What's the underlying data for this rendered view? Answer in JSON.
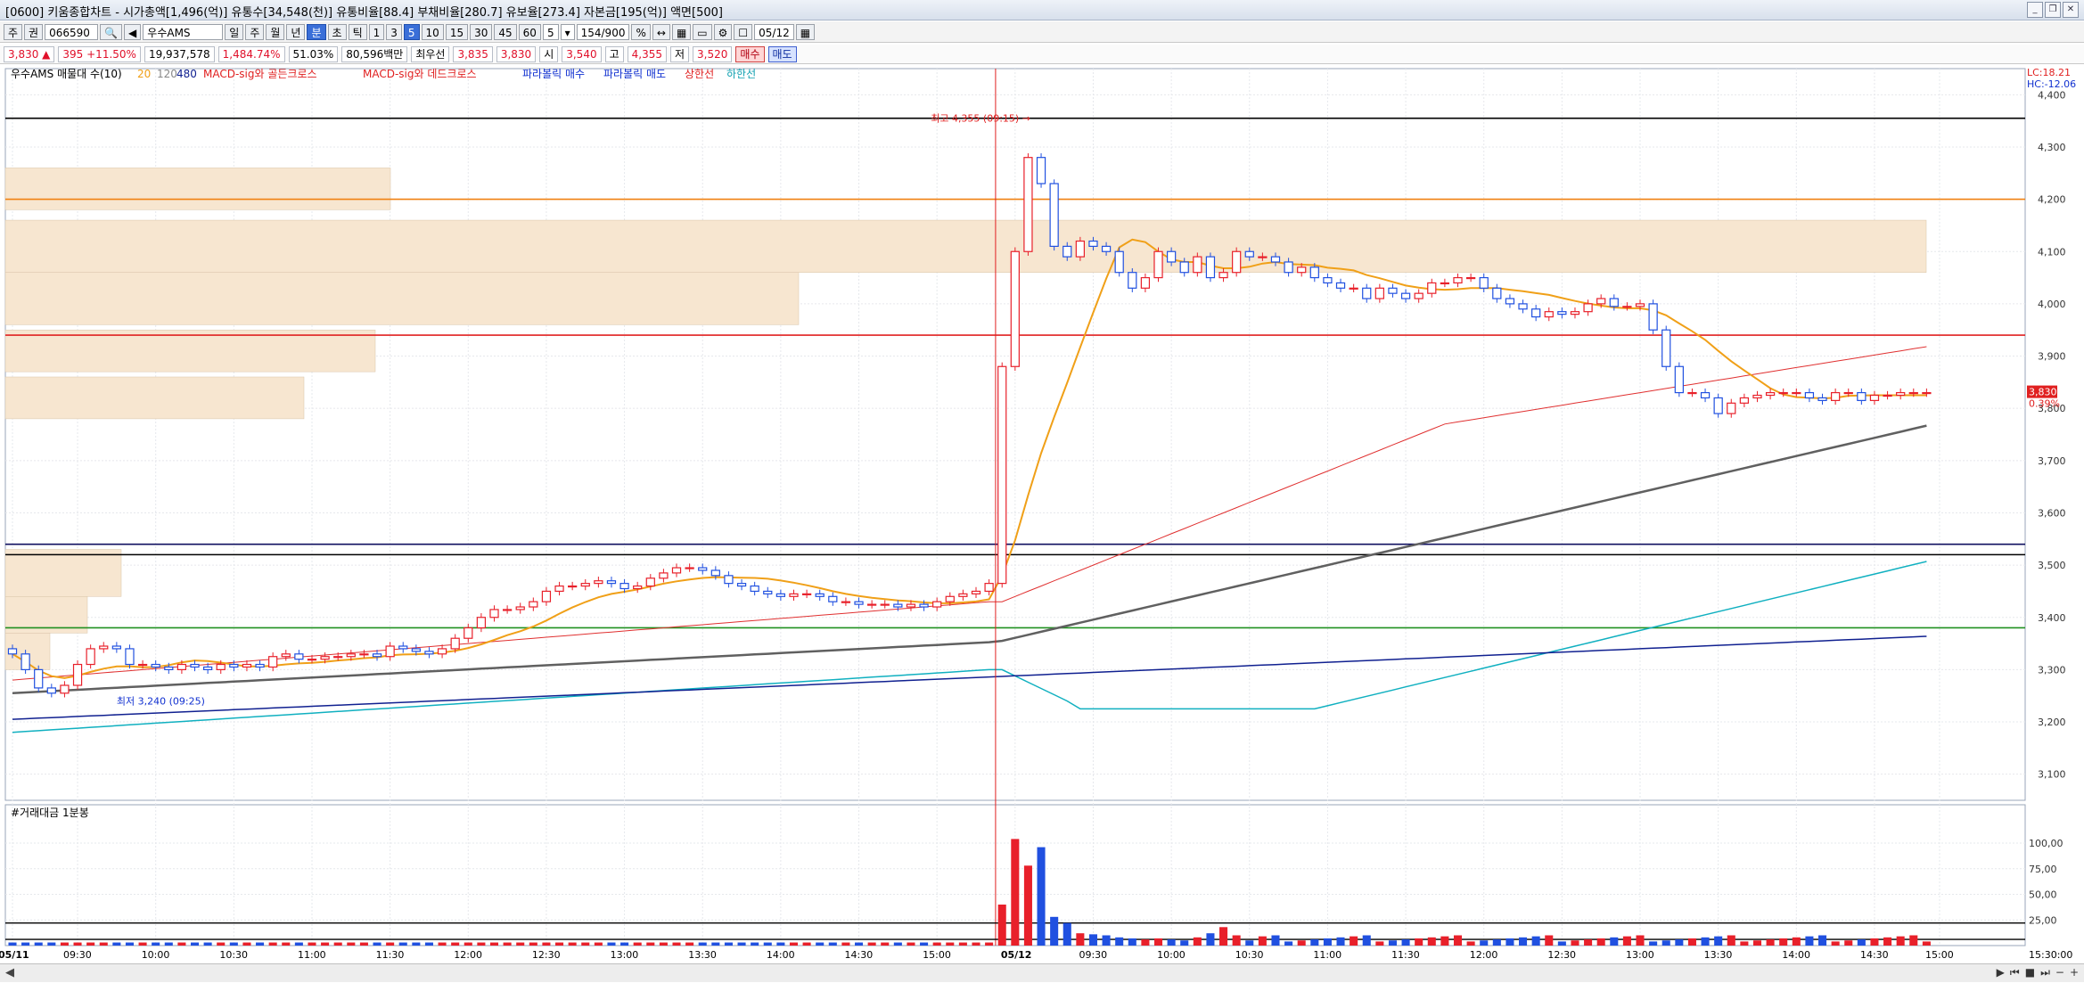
{
  "window": {
    "title": "[0600] 키움종합차트 - 시가총액[1,496(억)] 유통수[34,548(천)] 유통비율[88.4] 부채비율[280.7] 유보율[273.4] 자본금[195(억)] 액면[500]"
  },
  "toolbar": {
    "items": [
      "주",
      "권",
      "066590",
      "우수AMS",
      "일",
      "주",
      "월",
      "년",
      "분",
      "초",
      "틱",
      "1",
      "3",
      "5",
      "10",
      "15",
      "30",
      "45",
      "60",
      "5",
      "154/900",
      "05/12"
    ],
    "selected_period": "분",
    "selected_interval": "5"
  },
  "infobar": {
    "price": "3,830 ▲",
    "change": "395 +11.50%",
    "volume": "19,937,578",
    "vol_ratio": "1,484.74%",
    "turnover": "51.03%",
    "amount": "80,596백만",
    "best_label": "최우선",
    "ask": "3,835",
    "bid": "3,830",
    "open_label": "시",
    "open": "3,540",
    "high_label": "고",
    "high": "4,355",
    "low_label": "저",
    "low": "3,520",
    "buy_label": "매수",
    "sell_label": "매도"
  },
  "legend": {
    "name": "우수AMS 매물대 수(10)",
    "ma": [
      "20",
      "120",
      "480"
    ],
    "signals": [
      "MACD-sig와 골든크로스",
      "MACD-sig와 데드크로스",
      "파라볼릭 매수",
      "파라볼릭 매도",
      "상한선",
      "하한선"
    ],
    "lc": "LC:18.21",
    "hc": "HC:-12.06"
  },
  "volume_panel": {
    "label": "#거래대금 1분봉"
  },
  "annotations": {
    "high_note": "최고 4,355 (09:15) →",
    "low_note": "최저 3,240 (09:25)",
    "price_tag": "3,830",
    "pct_tag": "0.39%"
  },
  "colors": {
    "up": "#e8202a",
    "down": "#2050e0",
    "ma20": "#f0a018",
    "ma120": "#e03030",
    "ma480": "#606060",
    "upper": "#10b0c0",
    "lower": "#102090",
    "profile": "#f7e6d0"
  },
  "chart_data": {
    "type": "candlestick",
    "ylim": [
      3050,
      4450
    ],
    "y_ticks": [
      3100,
      3200,
      3300,
      3400,
      3500,
      3600,
      3700,
      3800,
      3900,
      4000,
      4100,
      4200,
      4300,
      4400
    ],
    "y_tick_labels": [
      "3,100",
      "3,200",
      "3,300",
      "3,400",
      "3,500",
      "3,600",
      "3,700",
      "3,800",
      "3,900",
      "4,000",
      "4,100",
      "4,200",
      "4,300",
      "4,400"
    ],
    "x_count": 148,
    "x_labels": [
      {
        "i": 0,
        "t": "05/11",
        "bold": true
      },
      {
        "i": 5,
        "t": "09:30"
      },
      {
        "i": 11,
        "t": "10:00"
      },
      {
        "i": 17,
        "t": "10:30"
      },
      {
        "i": 23,
        "t": "11:00"
      },
      {
        "i": 29,
        "t": "11:30"
      },
      {
        "i": 35,
        "t": "12:00"
      },
      {
        "i": 41,
        "t": "12:30"
      },
      {
        "i": 47,
        "t": "13:00"
      },
      {
        "i": 53,
        "t": "13:30"
      },
      {
        "i": 59,
        "t": "14:00"
      },
      {
        "i": 65,
        "t": "14:30"
      },
      {
        "i": 71,
        "t": "15:00"
      },
      {
        "i": 77,
        "t": "05/12",
        "bold": true
      },
      {
        "i": 83,
        "t": "09:30"
      },
      {
        "i": 89,
        "t": "10:00"
      },
      {
        "i": 95,
        "t": "10:30"
      },
      {
        "i": 101,
        "t": "11:00"
      },
      {
        "i": 107,
        "t": "11:30"
      },
      {
        "i": 113,
        "t": "12:00"
      },
      {
        "i": 119,
        "t": "12:30"
      },
      {
        "i": 125,
        "t": "13:00"
      },
      {
        "i": 131,
        "t": "13:30"
      },
      {
        "i": 137,
        "t": "14:00"
      },
      {
        "i": 143,
        "t": "14:30"
      },
      {
        "i": 148,
        "t": "15:00"
      }
    ],
    "last_time_label": "15:30:00",
    "day_break_index": 76,
    "series_close_day1": [
      3330,
      3300,
      3265,
      3255,
      3270,
      3310,
      3340,
      3345,
      3340,
      3310,
      3310,
      3305,
      3300,
      3310,
      3305,
      3300,
      3310,
      3305,
      3310,
      3305,
      3325,
      3330,
      3320,
      3320,
      3325,
      3325,
      3330,
      3330,
      3325,
      3345,
      3340,
      3335,
      3330,
      3340,
      3360,
      3380,
      3400,
      3415,
      3415,
      3420,
      3430,
      3450,
      3460,
      3460,
      3465,
      3470,
      3465,
      3455,
      3460,
      3475,
      3485,
      3495,
      3495,
      3490,
      3480,
      3465,
      3460,
      3450,
      3445,
      3440,
      3445,
      3445,
      3440,
      3430,
      3430,
      3425,
      3425,
      3425,
      3420,
      3425,
      3420,
      3430,
      3440,
      3445,
      3450,
      3465
    ],
    "series_close_day2": [
      3880,
      4100,
      4280,
      4230,
      4110,
      4090,
      4120,
      4110,
      4100,
      4060,
      4030,
      4050,
      4100,
      4080,
      4060,
      4090,
      4050,
      4060,
      4100,
      4090,
      4090,
      4080,
      4060,
      4070,
      4050,
      4040,
      4030,
      4030,
      4010,
      4030,
      4020,
      4010,
      4020,
      4040,
      4040,
      4050,
      4050,
      4030,
      4010,
      4000,
      3990,
      3975,
      3985,
      3980,
      3985,
      4000,
      4010,
      3995,
      3995,
      4000,
      3950,
      3880,
      3830,
      3830,
      3820,
      3790,
      3810,
      3820,
      3825,
      3830,
      3830,
      3830,
      3820,
      3815,
      3830,
      3830,
      3815,
      3825,
      3825,
      3830,
      3830,
      3830
    ],
    "ma20_note": "MA20 orange",
    "ma120_note": "MA120 red",
    "ma480_note": "MA480 gray",
    "horizontal_levels": [
      4355,
      4200,
      3940,
      3540,
      3520,
      3380
    ],
    "volume_ylim": [
      0,
      120
    ],
    "volume_ticks": [
      25,
      50,
      75,
      100
    ],
    "volume_tick_labels": [
      "25,00",
      "50,00",
      "75,00",
      "100,00"
    ]
  }
}
